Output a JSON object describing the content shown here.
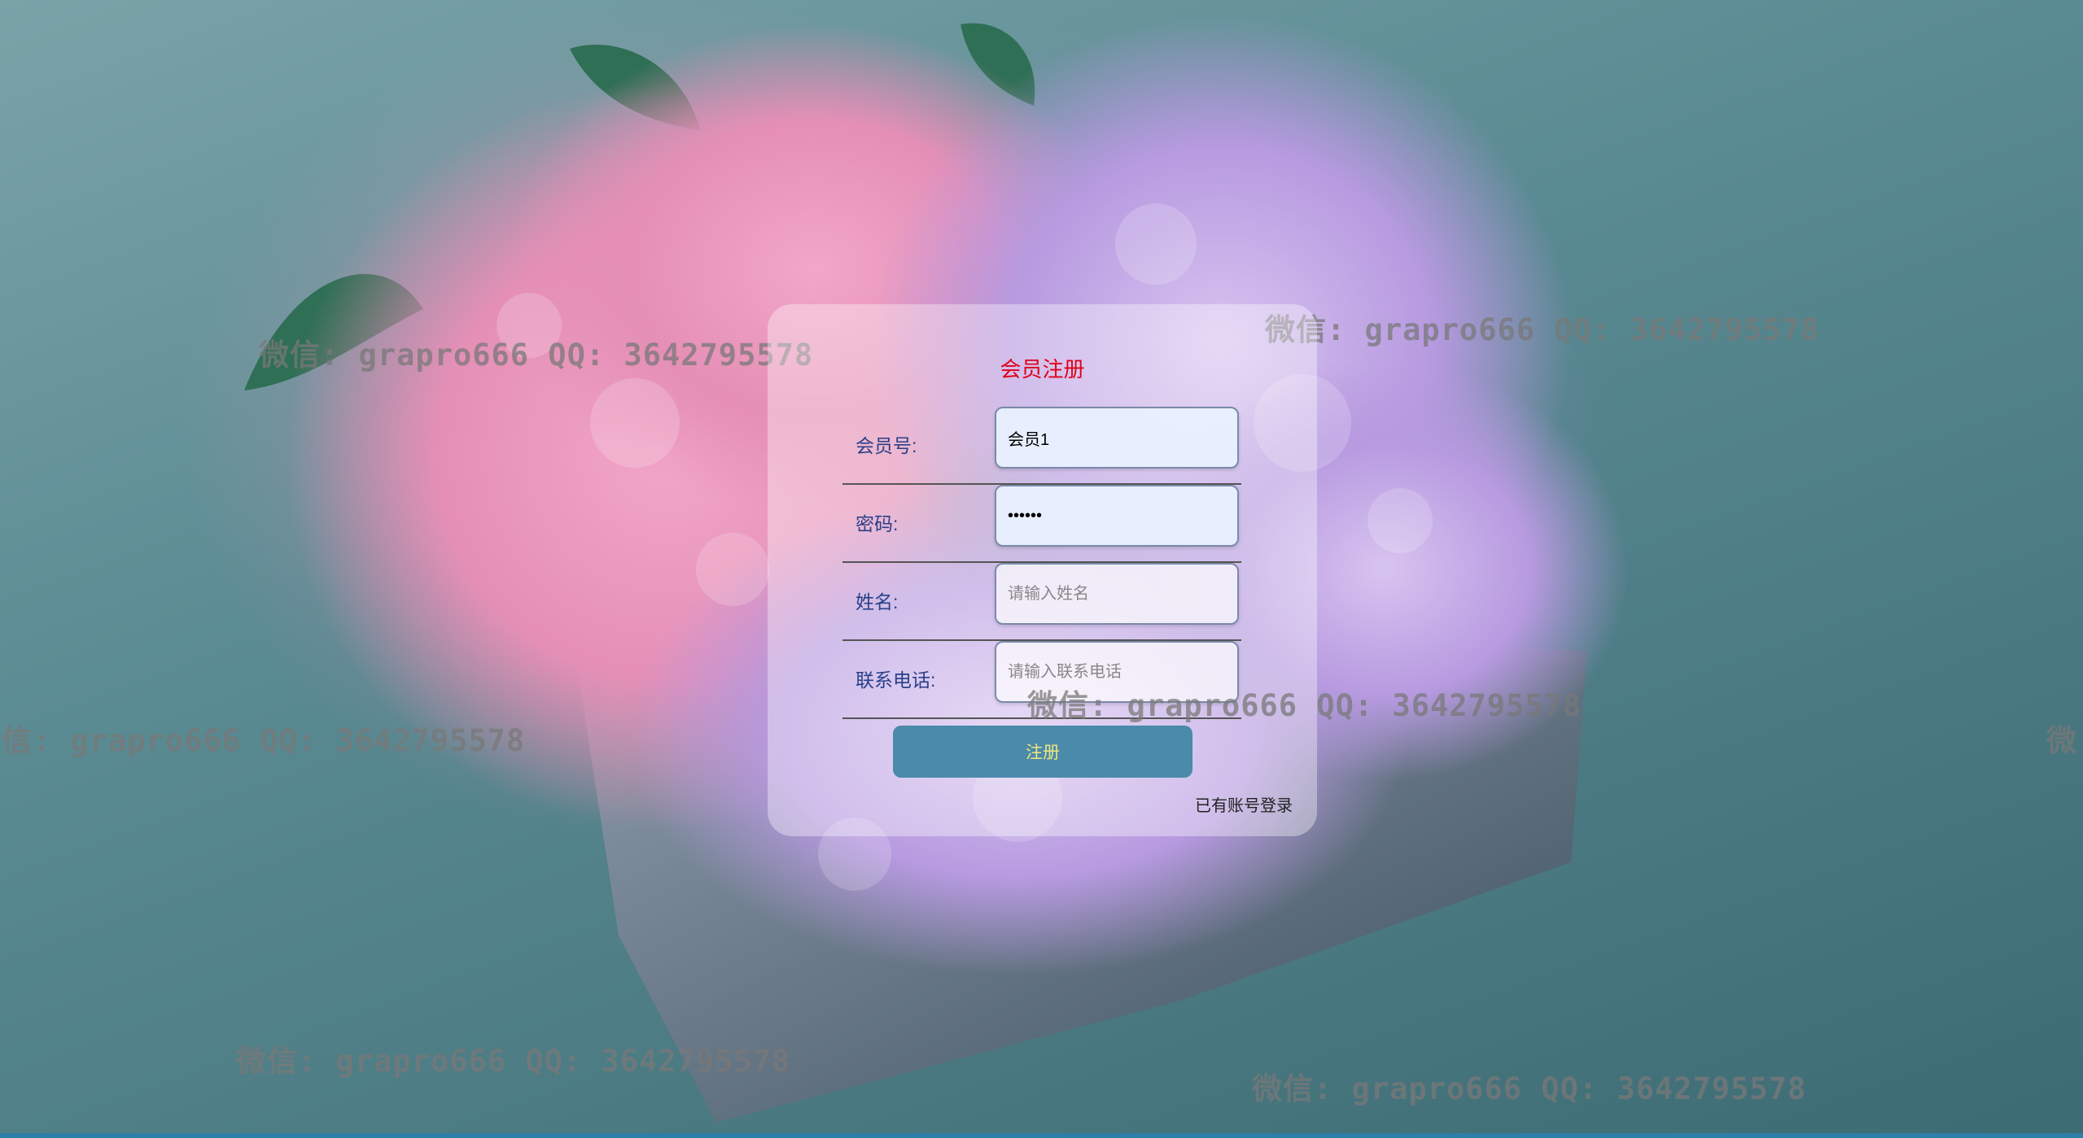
{
  "page": {
    "colors": {
      "title": "#e0001a",
      "label": "#2a3f88",
      "button_bg": "#4a8aaa",
      "button_text": "#f2e680"
    },
    "background_image": "hydrangea-bouquet"
  },
  "register_form": {
    "title": "会员注册",
    "fields": [
      {
        "label": "会员号:",
        "value": "会员1",
        "placeholder": ""
      },
      {
        "label": "密码:",
        "value": "••••••",
        "placeholder": ""
      },
      {
        "label": "姓名:",
        "value": "",
        "placeholder": "请输入姓名"
      },
      {
        "label": "联系电话:",
        "value": "",
        "placeholder": "请输入联系电话"
      }
    ],
    "submit_label": "注册",
    "login_link": "已有账号登录"
  },
  "watermarks": [
    "微信: grapro666 QQ: 3642795578",
    "微信: grapro666 QQ: 3642795578",
    "信: grapro666 QQ: 3642795578",
    "微信: grapro666 QQ: 3642795578",
    "微",
    "微信: grapro666 QQ: 3642795578",
    "微信: grapro666 QQ: 3642795578"
  ]
}
